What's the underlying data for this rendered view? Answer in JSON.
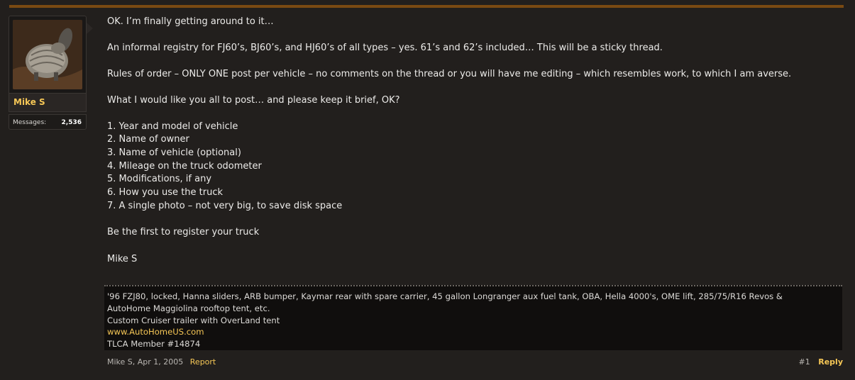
{
  "user": {
    "name": "Mike S",
    "stats": {
      "label": "Messages:",
      "value": "2,536"
    }
  },
  "message": {
    "paragraphs": [
      "OK. I’m finally getting around to it…",
      "An informal registry for FJ60’s, BJ60’s, and HJ60’s of all types – yes. 61’s and 62’s included… This will be a sticky thread.",
      "Rules of order – ONLY ONE post per vehicle – no comments on the thread or you will have me editing – which resembles work, to which I am averse.",
      "What I would like you all to post… and please keep it brief, OK?"
    ],
    "list": [
      "1. Year and model of vehicle",
      "2. Name of owner",
      "3. Name of vehicle (optional)",
      "4. Mileage on the truck odometer",
      "5. Modifications, if any",
      "6. How you use the truck",
      "7. A single photo – not very big, to save disk space"
    ],
    "closing": "Be the first to register your truck",
    "signoff": "Mike S"
  },
  "signature": {
    "line1": "'96 FZJ80, locked, Hanna sliders, ARB bumper, Kaymar rear with spare carrier, 45 gallon Longranger aux fuel tank, OBA, Hella 4000's, OME lift, 285/75/R16 Revos &",
    "line2": "AutoHome Maggiolina rooftop tent, etc.",
    "line3": "Custom Cruiser trailer with OverLand tent",
    "link": "www.AutoHomeUS.com",
    "line5": "TLCA Member #14874"
  },
  "footer": {
    "meta": "Mike S, Apr 1, 2005",
    "report": "Report",
    "post_number": "#1",
    "reply": "Reply"
  },
  "colors": {
    "background": "#221f1d",
    "accent_bar": "#7a4a12",
    "username": "#f6c756",
    "link": "#f6c756"
  }
}
